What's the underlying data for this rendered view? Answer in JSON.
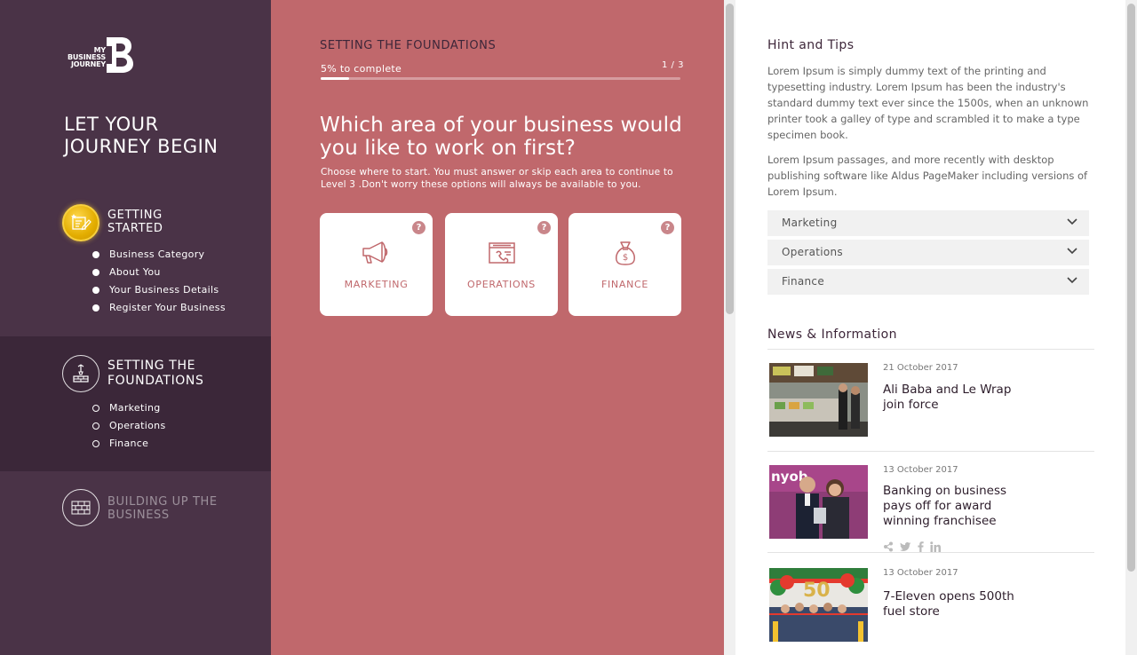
{
  "brand": {
    "logo_line1": "MY",
    "logo_line2": "BUSINESS",
    "logo_line3": "JOURNEY"
  },
  "sidebar": {
    "hero_line1": "LET YOUR",
    "hero_line2": "JOURNEY BEGIN",
    "stages": [
      {
        "title_line1": "GETTING",
        "title_line2": "STARTED",
        "status": "complete",
        "items": [
          "Business Category",
          "About You",
          "Your Business Details",
          "Register Your Business"
        ]
      },
      {
        "title_line1": "SETTING THE",
        "title_line2": "FOUNDATIONS",
        "status": "active",
        "items": [
          "Marketing",
          "Operations",
          "Finance"
        ]
      },
      {
        "title_line1": "BUILDING UP THE",
        "title_line2": "BUSINESS",
        "status": "locked",
        "items": []
      }
    ]
  },
  "main": {
    "section_label": "SETTING THE FOUNDATIONS",
    "progress_text": "5% to complete",
    "progress_value": 0.08,
    "step_indicator": "1 / 3",
    "question": "Which area of your business would you like to work on first?",
    "instructions": "Choose where to start. You must answer or skip each area to continue to Level 3 .Don't worry these options will always be available to you.",
    "cards": [
      {
        "label": "MARKETING",
        "icon": "megaphone-icon",
        "help": "?"
      },
      {
        "label": "OPERATIONS",
        "icon": "operations-icon",
        "help": "?"
      },
      {
        "label": "FINANCE",
        "icon": "money-bag-icon",
        "help": "?"
      }
    ],
    "accent_color": "#c0686c"
  },
  "right": {
    "hint_title": "Hint and Tips",
    "hint_p1": "Lorem Ipsum is simply dummy text of the printing and typesetting industry. Lorem Ipsum has been the industry's standard dummy text ever since the 1500s, when an unknown printer took a galley of type and scrambled it to make a type specimen book.",
    "hint_p2": "Lorem Ipsum passages, and more recently with desktop publishing software like Aldus PageMaker including versions of Lorem Ipsum.",
    "accordion": [
      "Marketing",
      "Operations",
      "Finance"
    ],
    "news_title": "News & Information",
    "news": [
      {
        "date": "21 October 2017",
        "headline": "Ali Baba and Le Wrap join force"
      },
      {
        "date": "13 October 2017",
        "headline": "Banking on business pays off for award winning franchisee"
      },
      {
        "date": "13 October 2017",
        "headline": "7-Eleven opens 500th fuel store"
      }
    ]
  },
  "colors": {
    "sidebar_bg": "#4a3347",
    "sidebar_active_bg": "#3b2739",
    "main_bg": "#c0686c",
    "gold": "#e3ad00"
  }
}
